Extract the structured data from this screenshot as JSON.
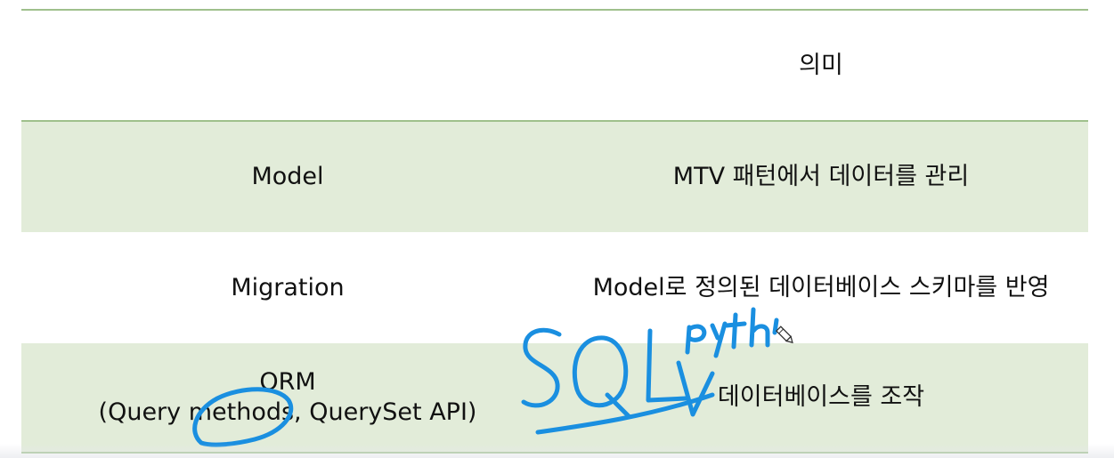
{
  "table": {
    "header": {
      "term": "",
      "meaning": "의미"
    },
    "rows": [
      {
        "term": "Model",
        "meaning": "MTV 패턴에서 데이터를 관리"
      },
      {
        "term": "Migration",
        "meaning": "Model로 정의된 데이터베이스 스키마를 반영"
      },
      {
        "term_line1": "ORM",
        "term_line2": "(Query methods, QuerySet API)",
        "meaning": "데이터베이스를 조작"
      }
    ]
  },
  "annotations": {
    "handwritten": [
      "SQL",
      "Pyth"
    ],
    "ink_color": "#1a8fe0"
  },
  "colors": {
    "row_green": "#e2ecd9",
    "rule_line": "#9fc08c",
    "text": "#111111"
  },
  "icons": [
    "pen-cursor-icon"
  ]
}
